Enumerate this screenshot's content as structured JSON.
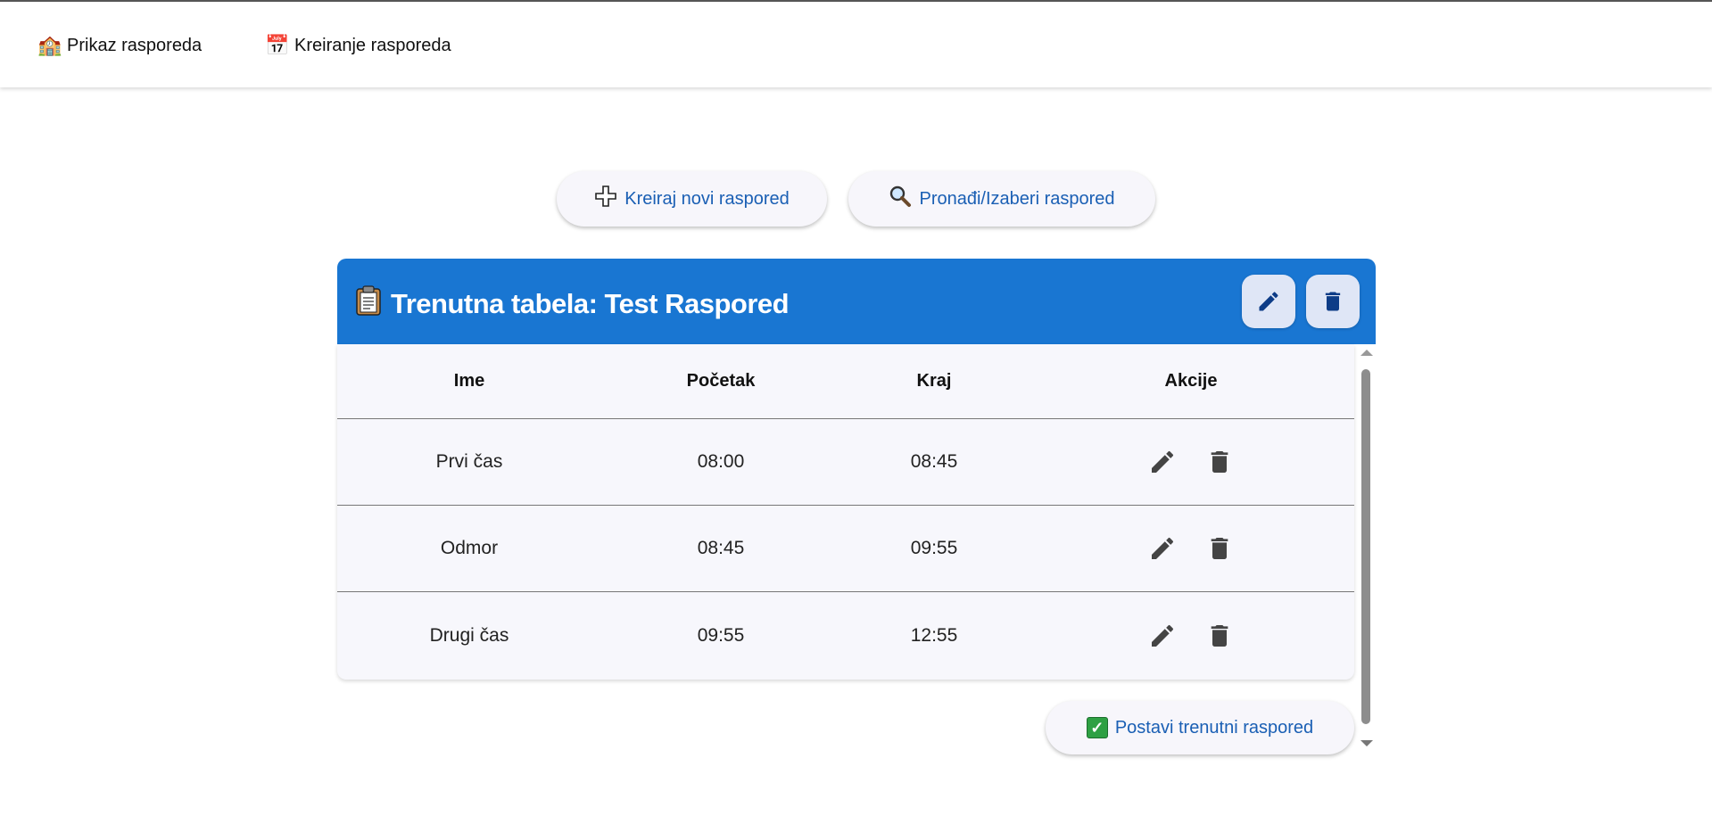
{
  "nav": {
    "items": [
      {
        "label": "Prikaz rasporeda",
        "icon": "school-building-icon",
        "glyph": "🏫"
      },
      {
        "label": "Kreiranje rasporeda",
        "icon": "calendar-icon",
        "glyph": "📅"
      }
    ]
  },
  "actions": {
    "create": {
      "label": "Kreiraj novi raspored",
      "icon": "plus-icon",
      "glyph": "➕"
    },
    "find": {
      "label": "Pronađi/Izaberi raspored",
      "icon": "magnifier-icon",
      "glyph": "🔍"
    }
  },
  "card": {
    "title": "Trenutna tabela: Test Raspored",
    "title_icon": "clipboard-icon",
    "title_glyph": "📋",
    "header_color": "#1976d2"
  },
  "table": {
    "columns": [
      "Ime",
      "Početak",
      "Kraj",
      "Akcije"
    ],
    "rows": [
      {
        "name": "Prvi čas",
        "start": "08:00",
        "end": "08:45"
      },
      {
        "name": "Odmor",
        "start": "08:45",
        "end": "09:55"
      },
      {
        "name": "Drugi čas",
        "start": "09:55",
        "end": "12:55"
      }
    ]
  },
  "footer": {
    "set_label": "Postavi trenutni raspored",
    "set_icon": "check-icon",
    "set_glyph": "✓"
  },
  "colors": {
    "accent": "#1976d2",
    "link": "#1a5fb4",
    "icon_dark": "#0d3c87"
  }
}
